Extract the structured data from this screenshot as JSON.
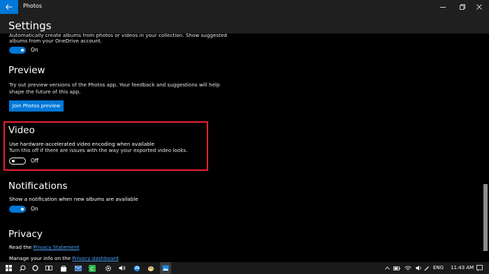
{
  "app": {
    "title": "Photos"
  },
  "header": {
    "title": "Settings"
  },
  "top_section": {
    "text_line1": "Automatically create albums from photos or videos in your collection. Show suggested",
    "text_line2": "albums from your OneDrive account.",
    "toggle_state": "On"
  },
  "preview": {
    "title": "Preview",
    "desc_line1": "Try out preview versions of the Photos app. Your feedback and suggestions will help",
    "desc_line2": "shape the future of this app.",
    "button_label": "Join Photos preview"
  },
  "video": {
    "title": "Video",
    "setting_label": "Use hardware-accelerated video encoding when available",
    "setting_desc": "Turn this off if there are issues with the way your exported video looks.",
    "toggle_state": "Off"
  },
  "notifications": {
    "title": "Notifications",
    "setting_label": "Show a notification when new albums are available",
    "toggle_state": "On"
  },
  "privacy": {
    "title": "Privacy",
    "read_prefix": "Read the ",
    "statement_link": "Privacy Statement",
    "manage_prefix": "Manage your info on the ",
    "dashboard_link": "Privacy dashboard"
  },
  "taskbar": {
    "language": "ENG",
    "time": "11:43 AM"
  },
  "colors": {
    "accent": "#0078d7",
    "highlight": "#e8202f"
  }
}
